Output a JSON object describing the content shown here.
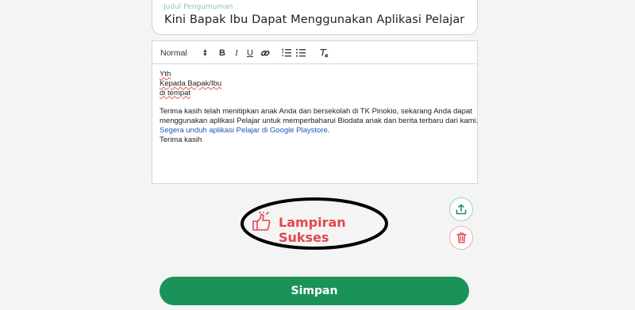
{
  "title_field": {
    "label": "Judul Pengumuman",
    "value": "Kini Bapak Ibu Dapat Menggunakan Aplikasi Pelajar"
  },
  "toolbar": {
    "format_select": "Normal",
    "bold": "B",
    "italic": "I",
    "underline": "U",
    "icons": [
      "link-icon",
      "ordered-list-icon",
      "bullet-list-icon",
      "clear-format-icon"
    ]
  },
  "body": {
    "line1": "Yth",
    "line2": "Kepada Bapak/Ibu",
    "line3": "di tempat",
    "para1_line1": "Terima kasih telah menitipkan anak Anda dan bersekolah di TK Pinokio, sekarang Anda dapat",
    "para1_line2": "menggunakan aplikasi Pelajar untuk memperbaharui Biodata anak dan berita terbaru dari kami.",
    "para2_link": "Segera unduh aplikasi Pelajar di Google Playstore",
    "para2_suffix": ".",
    "closing": "Terima kasih"
  },
  "attachment_status": {
    "text": "Lampiran Sukses",
    "icon": "thumbs-up-icon"
  },
  "actions": {
    "share_icon": "share-icon",
    "delete_icon": "trash-icon",
    "save_label": "Simpan"
  },
  "colors": {
    "primary_green": "#1b9358",
    "success_red": "#e2474d",
    "link_blue": "#1f56b8"
  }
}
